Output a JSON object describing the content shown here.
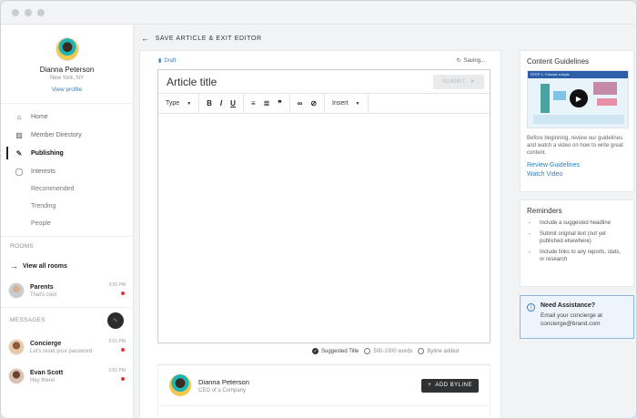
{
  "sidebar": {
    "profile": {
      "name": "Dianna Peterson",
      "location": "New York, NY",
      "link": "View profile"
    },
    "nav": [
      {
        "label": "Home",
        "icon": "home-icon"
      },
      {
        "label": "Member Directory",
        "icon": "contacts-icon"
      },
      {
        "label": "Publishing",
        "icon": "pencil-icon"
      },
      {
        "label": "Interests",
        "icon": "bulb-icon"
      }
    ],
    "sub_items": [
      "Recommended",
      "Trending",
      "People"
    ],
    "rooms": {
      "label": "ROOMS",
      "view_all": "View all rooms",
      "items": [
        {
          "name": "Parents",
          "preview": "That's cool",
          "time": "3:55 PM"
        }
      ]
    },
    "messages": {
      "label": "MESSAGES",
      "items": [
        {
          "name": "Concierge",
          "preview": "Let's reset your password",
          "time": "2:01 PM"
        },
        {
          "name": "Evan Scott",
          "preview": "Hey there!",
          "time": "2:01 PM"
        }
      ]
    }
  },
  "main": {
    "back_label": "SAVE ARTICLE & EXIT EDITOR",
    "status": {
      "draft": "Draft",
      "saving": "Saving..."
    },
    "editor": {
      "title_placeholder": "Article title",
      "submit_label": "SUBMIT",
      "toolbar": {
        "type_label": "Type",
        "insert_label": "Insert"
      }
    },
    "options": {
      "suggested_title": "Suggested Title",
      "word_count": "500-1000 words",
      "byline": "Byline added"
    },
    "byline": {
      "name": "Dianna Peterson",
      "role": "CEO of a Company",
      "add_label": "ADD BYLINE"
    }
  },
  "right": {
    "guidelines": {
      "title": "Content Guidelines",
      "video_caption": "STEP 1: Choose a topic",
      "description": "Before beginning, review our guidelines and watch a video on how to write great content.",
      "review_link": "Review Guidelines",
      "video_link": "Watch Video"
    },
    "reminders": {
      "title": "Reminders",
      "items": [
        "Include a suggested headline",
        "Submit original text (not yet published elsewhere)",
        "Include links to any reports, stats, or research"
      ]
    },
    "assistance": {
      "title": "Need Assistance?",
      "text": "Email your concierge at concierge@brand.com"
    }
  },
  "colors": {
    "link": "#2d7fc1",
    "unread": "#e0353b",
    "dark_button": "#2f3133"
  }
}
